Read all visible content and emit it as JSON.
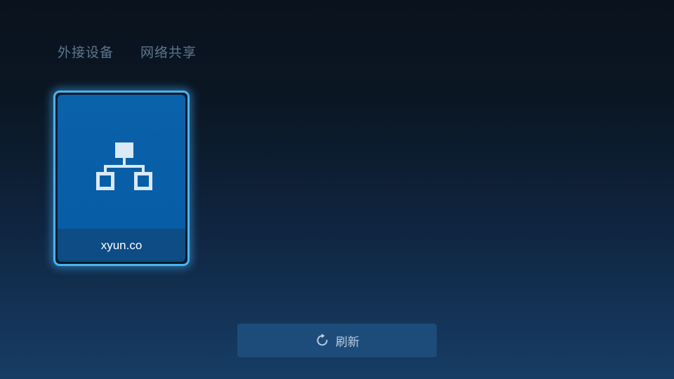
{
  "tabs": [
    {
      "label": "外接设备"
    },
    {
      "label": "网络共享"
    }
  ],
  "devices": [
    {
      "name": "xyun.co",
      "icon": "network-icon"
    }
  ],
  "refresh_button": {
    "label": "刷新",
    "icon": "refresh-icon"
  },
  "colors": {
    "card_focus_border": "#4ab4f2",
    "card_top": "#0a62aa",
    "card_bottom": "#0e4c85",
    "tab_text": "#5d7690",
    "button_bg": "#1d4c7b"
  }
}
